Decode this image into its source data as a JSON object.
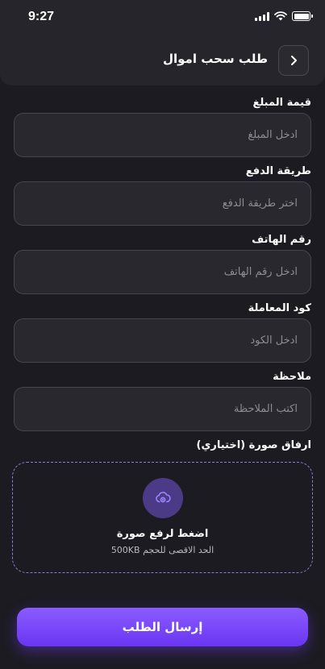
{
  "status_bar": {
    "time": "9:27",
    "icons": [
      "signal-icon",
      "wifi-icon",
      "battery-icon"
    ]
  },
  "header": {
    "title": "طلب سحب اموال",
    "back_icon": "chevron-right-icon"
  },
  "form": {
    "fields": [
      {
        "label": "قيمة المبلغ",
        "placeholder": "ادخل المبلغ",
        "value": ""
      },
      {
        "label": "طريقة الدفع",
        "placeholder": "اختر طريقة الدفع",
        "value": ""
      },
      {
        "label": "رقم الهاتف",
        "placeholder": "ادخل رقم الهاتف",
        "value": ""
      },
      {
        "label": "كود المعاملة",
        "placeholder": "ادخل الكود",
        "value": ""
      },
      {
        "label": "ملاحظة",
        "placeholder": "اكتب الملاحظة",
        "value": ""
      }
    ],
    "upload": {
      "label": "ارفاق صورة (اختياري)",
      "title": "اضغط لرفع صورة",
      "subtitle": "الحد الاقصى للحجم 500KB",
      "icon": "upload-cloud-icon"
    }
  },
  "submit": {
    "label": "إرسال الطلب"
  },
  "colors": {
    "background": "#1c1b21",
    "card": "#26252b",
    "input_bg": "#29282e",
    "input_border": "#46454c",
    "accent": "#7c4dff",
    "upload_border": "#8a7fd0"
  }
}
